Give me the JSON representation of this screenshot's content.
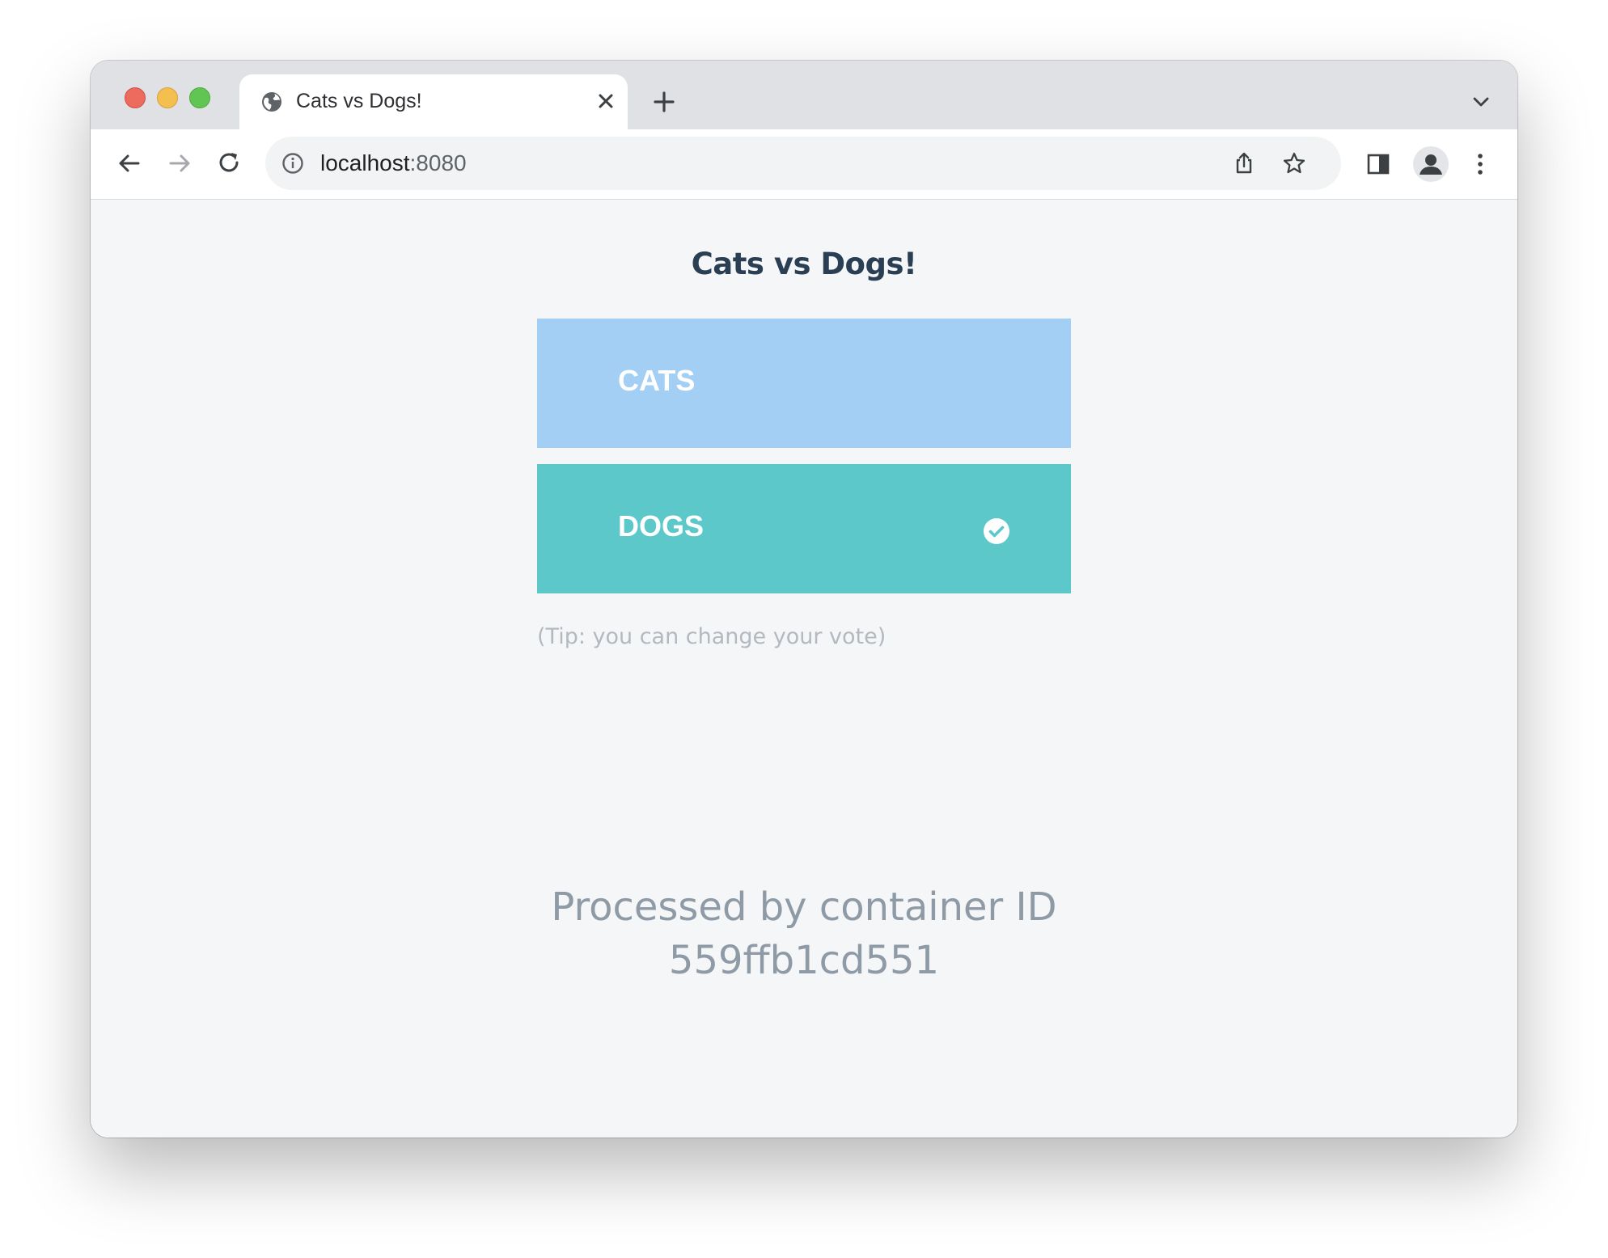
{
  "browser": {
    "tab": {
      "title": "Cats vs Dogs!"
    },
    "address_bar": {
      "host": "localhost",
      "port": ":8080"
    }
  },
  "page": {
    "heading": "Cats vs Dogs!",
    "options": [
      {
        "label": "CATS",
        "selected": false,
        "color": "#a3cff5"
      },
      {
        "label": "DOGS",
        "selected": true,
        "color": "#5cc8ca"
      }
    ],
    "tip": "(Tip: you can change your vote)",
    "processed_line1": "Processed by container ID",
    "container_id": "559ffb1cd551"
  },
  "icons": {
    "tab_favicon": "globe-icon",
    "selected_option": "check-circle-icon"
  }
}
